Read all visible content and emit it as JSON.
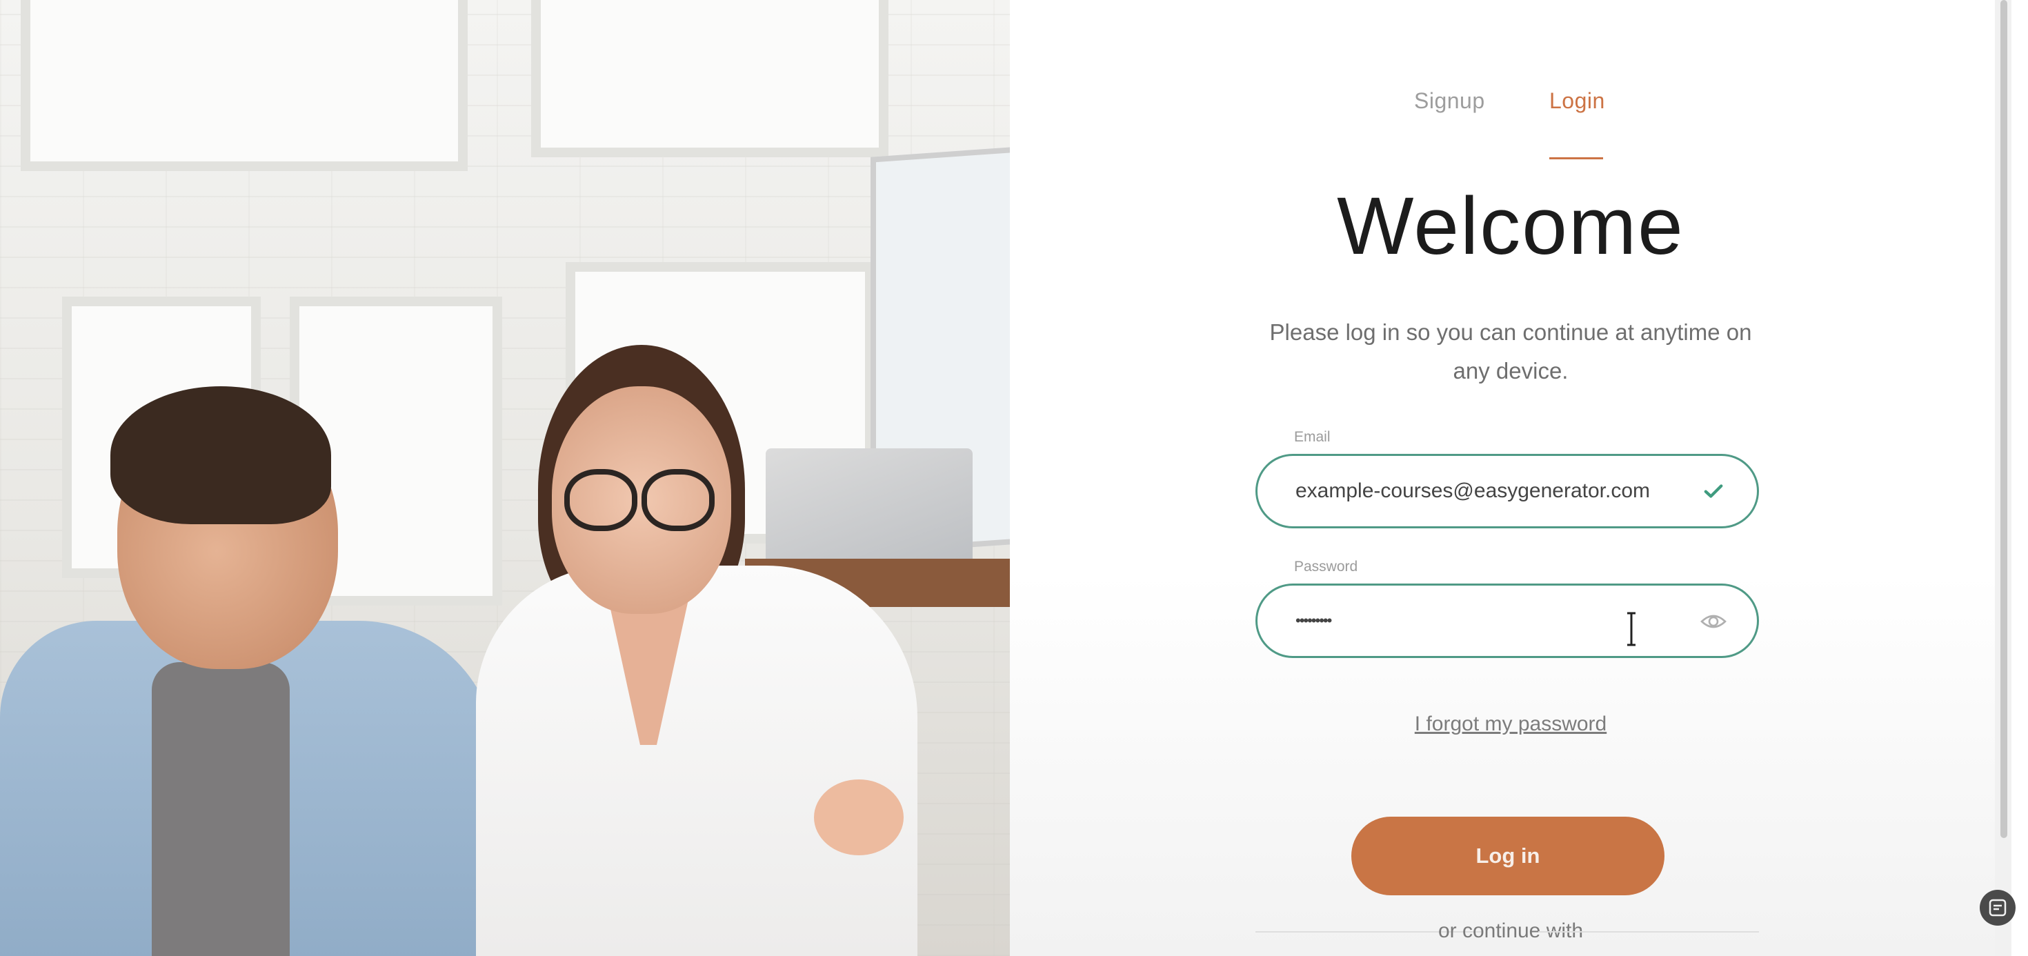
{
  "tabs": {
    "signup": "Signup",
    "login": "Login",
    "active": "login"
  },
  "title": "Welcome",
  "subtitle": "Please log in so you can continue at anytime on any device.",
  "email": {
    "label": "Email",
    "value": "example-courses@easygenerator.com",
    "valid": true
  },
  "password": {
    "label": "Password",
    "masked_value": "•••••••••"
  },
  "forgot_password": "I forgot my password",
  "login_button": "Log in",
  "continue_with": "or continue with",
  "icons": [
    "check-icon",
    "eye-icon",
    "text-cursor-icon",
    "scan-icon"
  ],
  "colors": {
    "accent": "#cc7344",
    "button": "#c97545",
    "field_border": "#4f9a86",
    "check": "#3f9b7f"
  }
}
